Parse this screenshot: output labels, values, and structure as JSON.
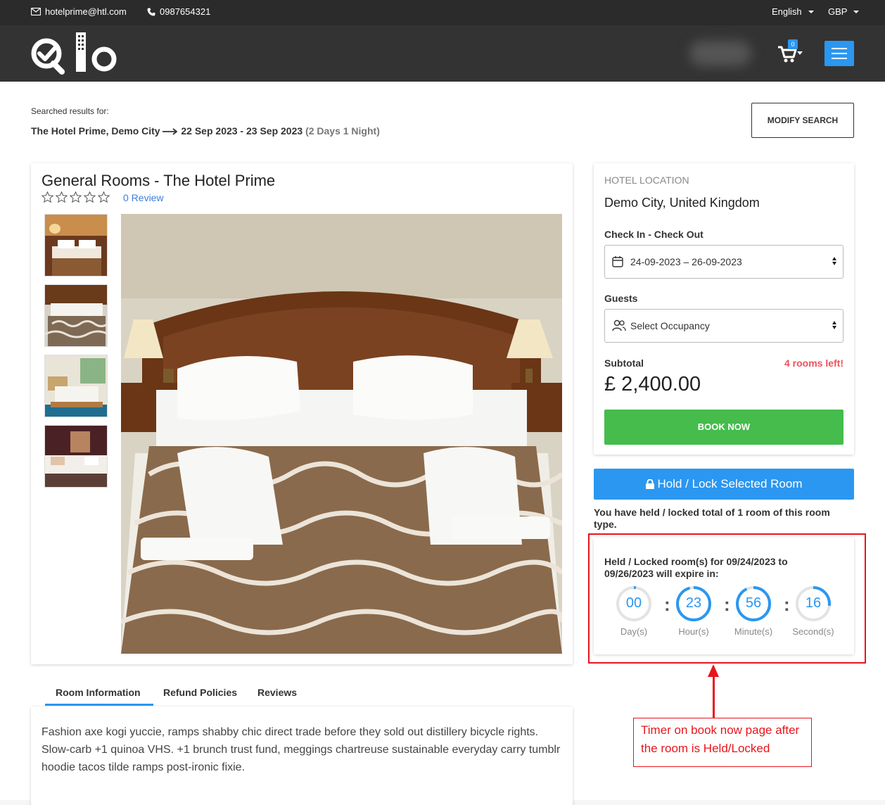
{
  "topbar": {
    "email": "hotelprime@htl.com",
    "phone": "0987654321",
    "language": "English",
    "currency": "GBP"
  },
  "navbar": {
    "cart_count": "0"
  },
  "search": {
    "label": "Searched results for:",
    "hotel": "The Hotel Prime, Demo City",
    "dates": "22 Sep 2023 - 23 Sep 2023",
    "duration": "(2 Days 1 Night)",
    "modify_label": "MODIFY SEARCH"
  },
  "room": {
    "title": "General Rooms  - The Hotel Prime",
    "rating": 0,
    "review_label": "0 Review"
  },
  "booking": {
    "location_label": "HOTEL LOCATION",
    "location": "Demo City, United Kingdom",
    "checkin_label": "Check In - Check Out",
    "dates_value": "24-09-2023  –  26-09-2023",
    "guests_label": "Guests",
    "guests_placeholder": "Select Occupancy",
    "subtotal_label": "Subtotal",
    "rooms_left": "4 rooms left!",
    "price": "£ 2,400.00",
    "book_label": "BOOK NOW"
  },
  "hold": {
    "button_label": "Hold / Lock Selected Room",
    "note": "You have held / locked total of 1 room of this room type.",
    "timer_title": "Held / Locked room(s) for 09/24/2023 to 09/26/2023 will expire in:",
    "units": [
      {
        "value": "00",
        "label": "Day(s)",
        "progress": 0.02
      },
      {
        "value": "23",
        "label": "Hour(s)",
        "progress": 0.96
      },
      {
        "value": "56",
        "label": "Minute(s)",
        "progress": 0.93
      },
      {
        "value": "16",
        "label": "Second(s)",
        "progress": 0.27
      }
    ]
  },
  "annotation": {
    "text": "Timer on book now page after the room is Held/Locked"
  },
  "tabs": [
    {
      "label": "Room Information"
    },
    {
      "label": "Refund Policies"
    },
    {
      "label": "Reviews"
    }
  ],
  "info": {
    "text": "Fashion axe kogi yuccie, ramps shabby chic direct trade before they sold out distillery bicycle rights. Slow-carb +1 quinoa VHS. +1 brunch trust fund, meggings chartreuse sustainable everyday carry tumblr hoodie tacos tilde ramps post-ironic fixie."
  },
  "colors": {
    "accent": "#2b97f0",
    "book": "#45bc4c",
    "alert": "#f0505a",
    "annotation": "#e8151b"
  }
}
